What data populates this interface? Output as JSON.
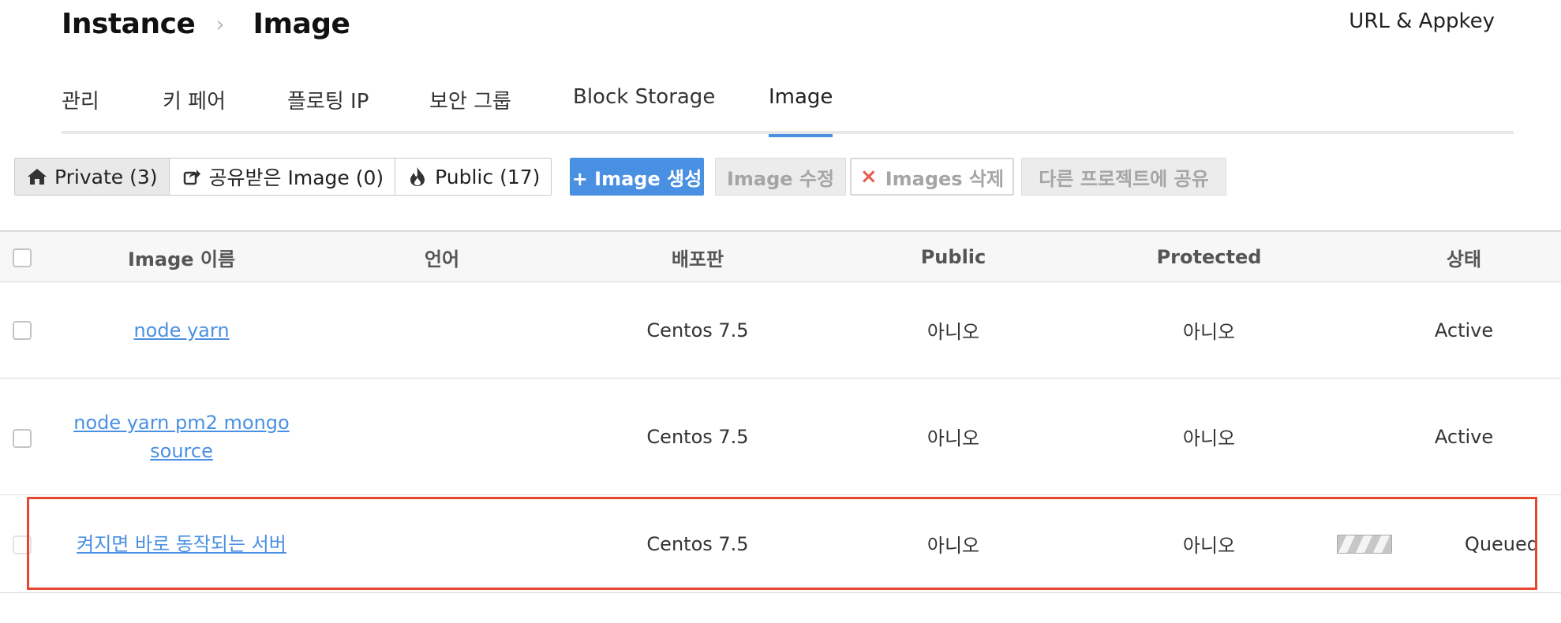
{
  "breadcrumb": {
    "root": "Instance",
    "current": "Image"
  },
  "header_link": "URL & Appkey",
  "tabs": [
    {
      "label": "관리"
    },
    {
      "label": "키 페어"
    },
    {
      "label": "플로팅 IP"
    },
    {
      "label": "보안 그룹"
    },
    {
      "label": "Block Storage"
    },
    {
      "label": "Image",
      "active": true
    }
  ],
  "filters": [
    {
      "label": "Private (3)",
      "icon": "home-icon",
      "active": true
    },
    {
      "label": "공유받은 Image (0)",
      "icon": "share-icon"
    },
    {
      "label": "Public (17)",
      "icon": "flame-icon"
    }
  ],
  "actions": {
    "create": "+ Image 생성",
    "edit": "Image 수정",
    "delete_icon": "×",
    "delete": "Images 삭제",
    "share": "다른 프로젝트에 공유"
  },
  "table": {
    "columns": [
      "Image 이름",
      "언어",
      "배포판",
      "Public",
      "Protected",
      "상태"
    ],
    "rows": [
      {
        "name": "node yarn",
        "language": "",
        "distribution": "Centos 7.5",
        "public": "아니오",
        "protected": "아니오",
        "status": "Active"
      },
      {
        "name": "node yarn pm2 mongo source",
        "language": "",
        "distribution": "Centos 7.5",
        "public": "아니오",
        "protected": "아니오",
        "status": "Active"
      },
      {
        "name": "켜지면 바로 동작되는 서버",
        "language": "",
        "distribution": "Centos 7.5",
        "public": "아니오",
        "protected": "아니오",
        "status": "Queued"
      }
    ]
  },
  "colors": {
    "accent": "#4a90e2",
    "highlight": "#e4482f",
    "delete_x": "#e8584e"
  }
}
